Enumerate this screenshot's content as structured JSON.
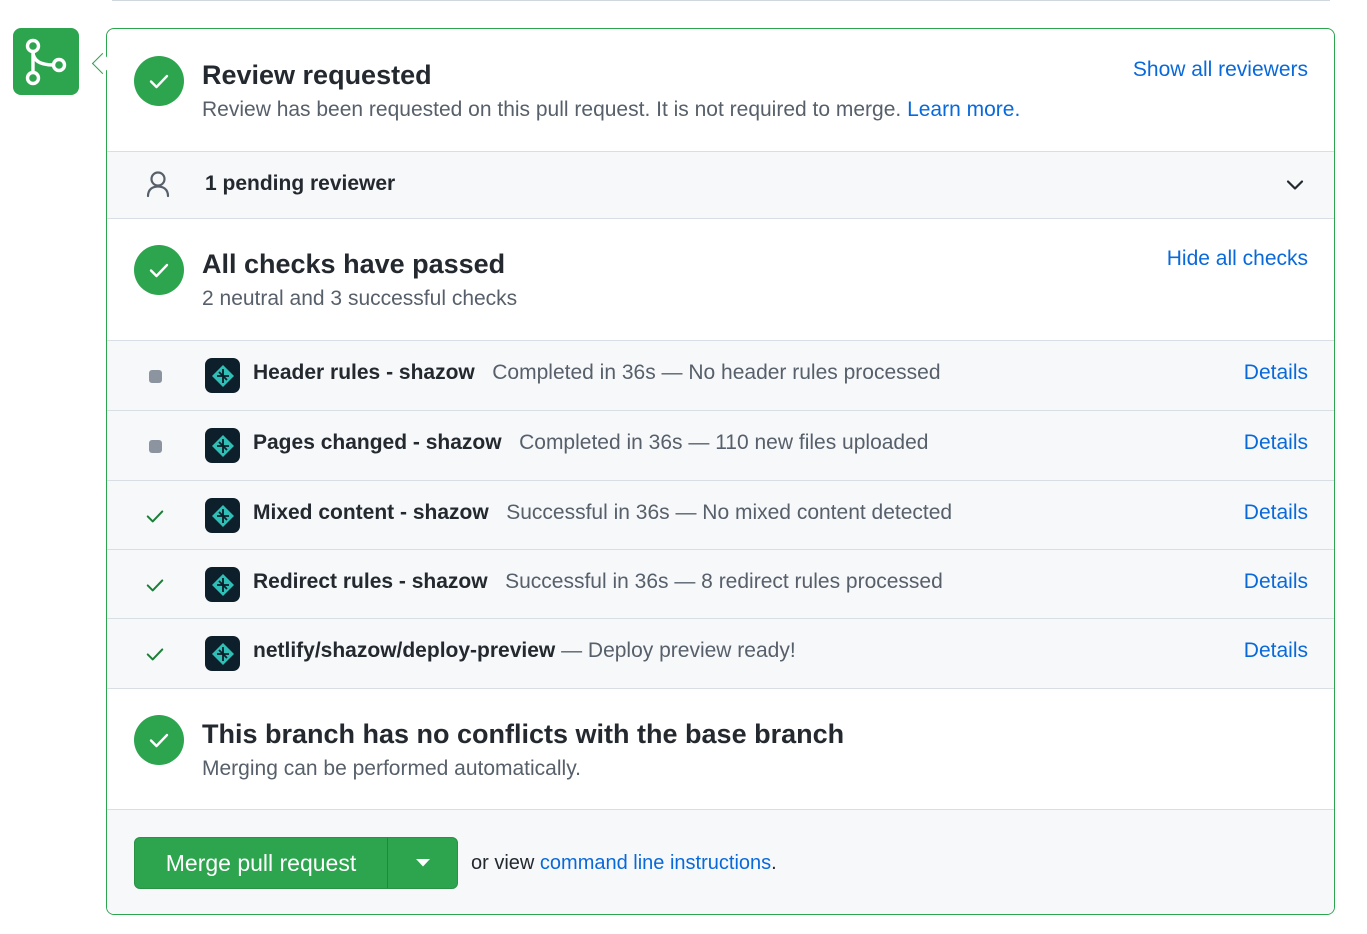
{
  "review": {
    "title": "Review requested",
    "subtitle": "Review has been requested on this pull request. It is not required to merge.",
    "learn_more": "Learn more",
    "period": ".",
    "show_all": "Show all reviewers",
    "pending": "1 pending reviewer"
  },
  "checks": {
    "title": "All checks have passed",
    "subtitle": "2 neutral and 3 successful checks",
    "hide_all": "Hide all checks",
    "items": [
      {
        "status": "neutral",
        "name": "Header rules - shazow",
        "description": "Completed in 36s — No header rules processed",
        "details": "Details"
      },
      {
        "status": "neutral",
        "name": "Pages changed - shazow",
        "description": "Completed in 36s — 110 new files uploaded",
        "details": "Details"
      },
      {
        "status": "success",
        "name": "Mixed content - shazow",
        "description": "Successful in 36s — No mixed content detected",
        "details": "Details"
      },
      {
        "status": "success",
        "name": "Redirect rules - shazow",
        "description": "Successful in 36s — 8 redirect rules processed",
        "details": "Details"
      },
      {
        "status": "success",
        "name": "netlify/shazow/deploy-preview",
        "description": "— Deploy preview ready!",
        "details": "Details"
      }
    ]
  },
  "conflicts": {
    "title": "This branch has no conflicts with the base branch",
    "subtitle": "Merging can be performed automatically."
  },
  "merge": {
    "button": "Merge pull request",
    "or_view": "or view",
    "cli_link": "command line instructions",
    "period": "."
  },
  "colors": {
    "success": "#2da44e",
    "link": "#0969da",
    "neutral": "#8c959f"
  }
}
